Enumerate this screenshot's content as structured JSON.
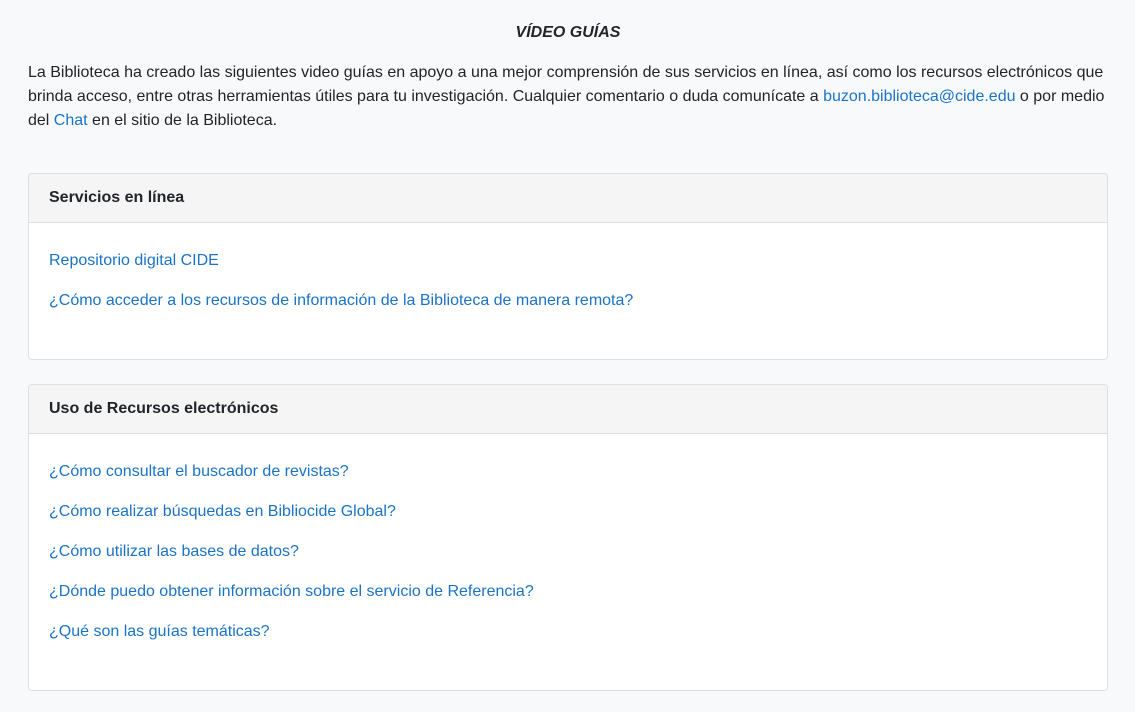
{
  "header": {
    "title": "VÍDEO GUÍAS"
  },
  "intro": {
    "text_before_email": "La Biblioteca ha creado las siguientes video guías en apoyo a una mejor comprensión de sus servicios en línea, así como los recursos electrónicos que brinda acceso, entre otras herramientas útiles para tu investigación. Cualquier comentario o duda comunícate a ",
    "email_link": "buzon.biblioteca@cide.edu",
    "text_between": " o por medio del ",
    "chat_link": "Chat",
    "text_after": " en el sitio de la Biblioteca."
  },
  "sections": [
    {
      "title": "Servicios en línea",
      "links": [
        "Repositorio digital CIDE",
        "¿Cómo acceder a los recursos de información de la Biblioteca de manera remota?"
      ]
    },
    {
      "title": "Uso de Recursos electrónicos",
      "links": [
        "¿Cómo consultar el buscador de revistas?",
        "¿Cómo realizar búsquedas en Bibliocide Global?",
        "¿Cómo utilizar las bases de datos?",
        "¿Dónde puedo obtener información sobre el servicio de Referencia?",
        "¿Qué son las guías temáticas?"
      ]
    }
  ],
  "colors": {
    "link": "#1a73c7",
    "background": "#f8f9fa",
    "card_header_bg": "#f5f5f5",
    "border": "#dfdfdf"
  }
}
